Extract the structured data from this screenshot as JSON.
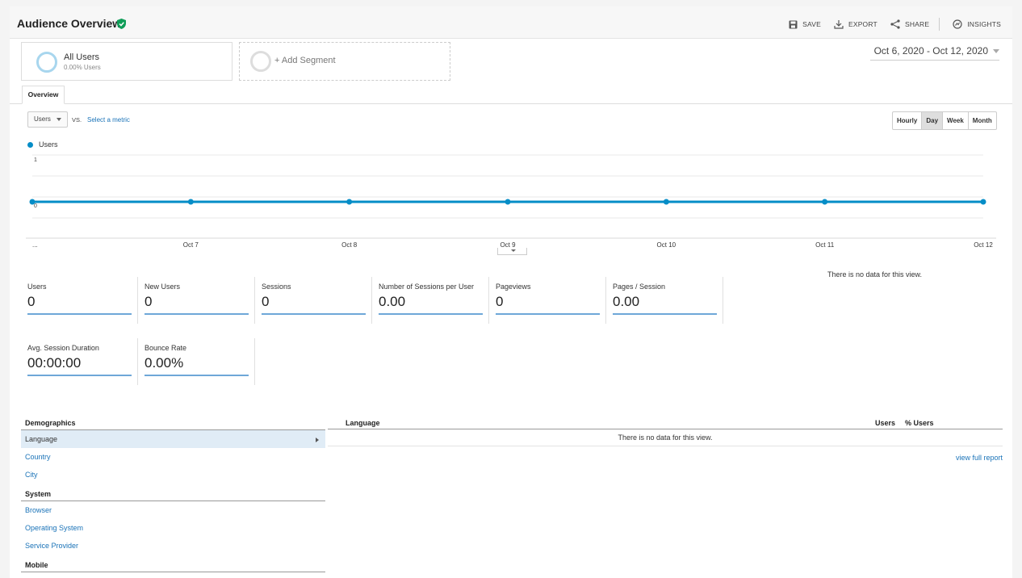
{
  "header": {
    "title": "Audience Overview",
    "actions": [
      {
        "label": "SAVE",
        "icon": "save-icon"
      },
      {
        "label": "EXPORT",
        "icon": "export-icon"
      },
      {
        "label": "SHARE",
        "icon": "share-icon"
      },
      {
        "label": "INSIGHTS",
        "icon": "insights-icon"
      }
    ]
  },
  "segments": {
    "all_users": {
      "name": "All Users",
      "sub": "0.00% Users"
    },
    "add_label": "+ Add Segment"
  },
  "date_range": "Oct 6, 2020 - Oct 12, 2020",
  "tabs": [
    "Overview"
  ],
  "metric_selector": {
    "value": "Users",
    "vs": "VS.",
    "select_metric": "Select a metric"
  },
  "granularity": {
    "options": [
      "Hourly",
      "Day",
      "Week",
      "Month"
    ],
    "selected": "Day"
  },
  "chart_data": {
    "type": "line",
    "series": [
      {
        "name": "Users",
        "values": [
          0,
          0,
          0,
          0,
          0,
          0,
          0
        ]
      }
    ],
    "categories": [
      "...",
      "Oct 7",
      "Oct 8",
      "Oct 9",
      "Oct 10",
      "Oct 11",
      "Oct 12"
    ],
    "y_ticks": [
      "1",
      "0"
    ],
    "ylim": [
      0,
      1
    ],
    "color": "#058dc7",
    "grid": true
  },
  "scorecards": [
    {
      "label": "Users",
      "value": "0"
    },
    {
      "label": "New Users",
      "value": "0"
    },
    {
      "label": "Sessions",
      "value": "0"
    },
    {
      "label": "Number of Sessions per User",
      "value": "0.00"
    },
    {
      "label": "Pageviews",
      "value": "0"
    },
    {
      "label": "Pages / Session",
      "value": "0.00"
    },
    {
      "label": "Avg. Session Duration",
      "value": "00:00:00"
    },
    {
      "label": "Bounce Rate",
      "value": "0.00%"
    }
  ],
  "pie_no_data": "There is no data for this view.",
  "demographics": {
    "sections": [
      {
        "title": "Demographics",
        "items": [
          "Language",
          "Country",
          "City"
        ]
      },
      {
        "title": "System",
        "items": [
          "Browser",
          "Operating System",
          "Service Provider"
        ]
      },
      {
        "title": "Mobile",
        "items": []
      }
    ],
    "active": "Language"
  },
  "language_table": {
    "title": "Language",
    "columns": [
      "Users",
      "% Users"
    ],
    "empty_text": "There is no data for this view.",
    "view_full_report": "view full report"
  }
}
